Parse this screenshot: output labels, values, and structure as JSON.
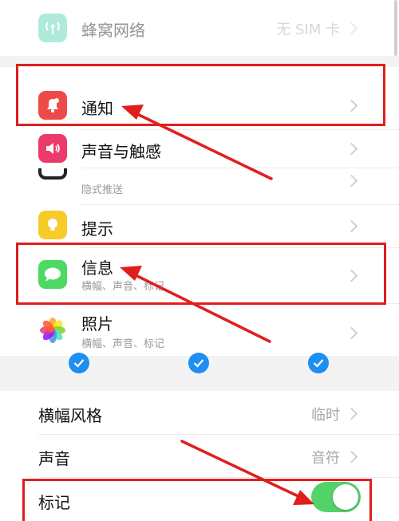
{
  "settings": {
    "cellular": {
      "title": "蜂窝网络",
      "value": "无 SIM 卡"
    },
    "notifications": {
      "title": "通知"
    },
    "sounds": {
      "title": "声音与触感"
    },
    "partial": {
      "subtitle": "隐式推送"
    },
    "tips": {
      "title": "提示"
    },
    "messages": {
      "title": "信息",
      "subtitle": "横幅、声音、标记"
    },
    "photos": {
      "title": "照片",
      "subtitle": "横幅、声音、标记"
    }
  },
  "alerts": {
    "checks": 3,
    "banner_style": {
      "label": "横幅风格",
      "value": "临时"
    },
    "sound": {
      "label": "声音",
      "value": "音符"
    },
    "badges": {
      "label": "标记",
      "enabled": true
    }
  },
  "colors": {
    "annotation_red": "#e01e1e",
    "toggle_on": "#52d36a",
    "check_blue": "#1e8ff0"
  }
}
